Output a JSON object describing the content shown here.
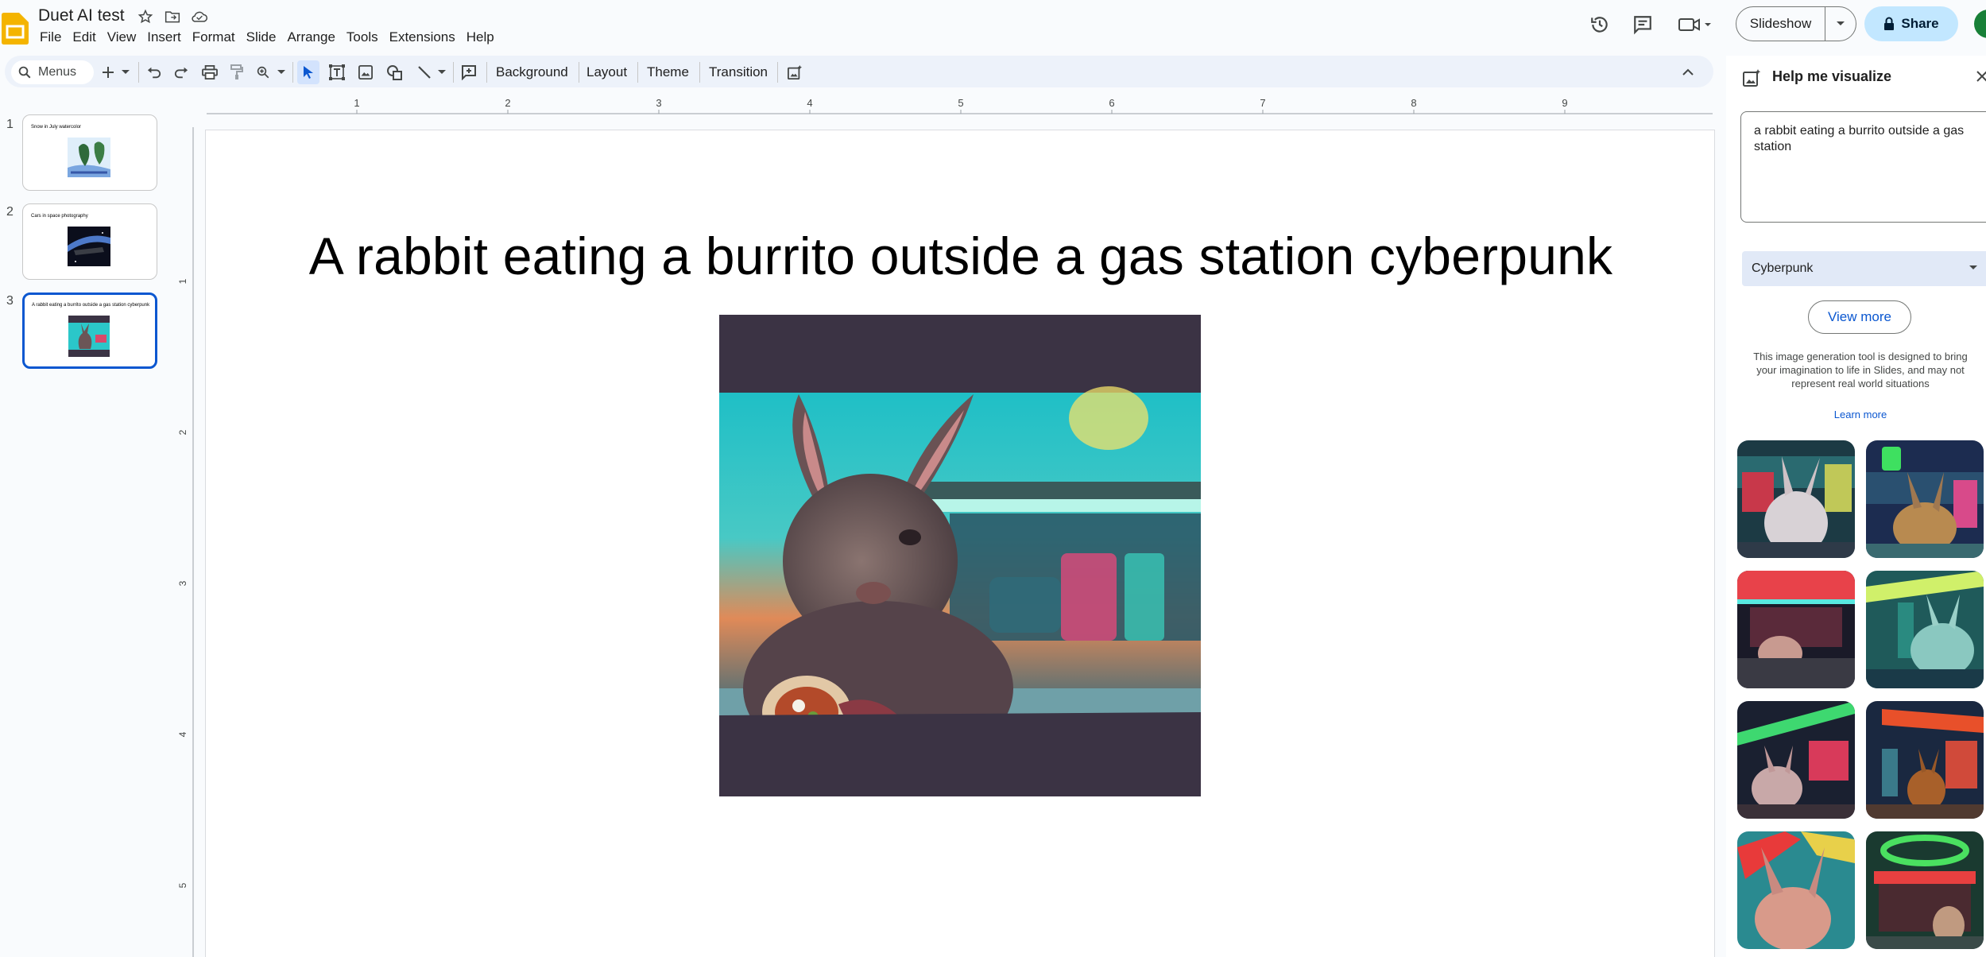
{
  "doc": {
    "title": "Duet AI test"
  },
  "menu": [
    "File",
    "Edit",
    "View",
    "Insert",
    "Format",
    "Slide",
    "Arrange",
    "Tools",
    "Extensions",
    "Help"
  ],
  "header": {
    "slideshow_label": "Slideshow",
    "share_label": "Share"
  },
  "toolbar": {
    "menus_label": "Menus",
    "background_label": "Background",
    "layout_label": "Layout",
    "theme_label": "Theme",
    "transition_label": "Transition"
  },
  "ruler": {
    "top_ticks": [
      "1",
      "2",
      "3",
      "4",
      "5",
      "6",
      "7",
      "8",
      "9"
    ],
    "left_ticks": [
      "1",
      "2",
      "3",
      "4",
      "5"
    ]
  },
  "slides": [
    {
      "number": "1",
      "title": "Snow in July watercolor"
    },
    {
      "number": "2",
      "title": "Cars in space photography"
    },
    {
      "number": "3",
      "title": "A rabbit eating a burrito outside a gas station cyberpunk"
    }
  ],
  "canvas": {
    "title": "A rabbit eating a burrito outside a gas station cyberpunk"
  },
  "panel": {
    "title": "Help me visualize",
    "prompt": "a rabbit eating a burrito outside a gas station",
    "style_value": "Cyberpunk",
    "view_more_label": "View more",
    "disclaimer": "This image generation tool is designed to bring your imagination to life in Slides, and may not represent real world situations",
    "learn_more_label": "Learn more"
  },
  "colors": {
    "accent": "#0b57d0",
    "share_bg": "#c2e7ff",
    "logo": "#f4b400"
  }
}
